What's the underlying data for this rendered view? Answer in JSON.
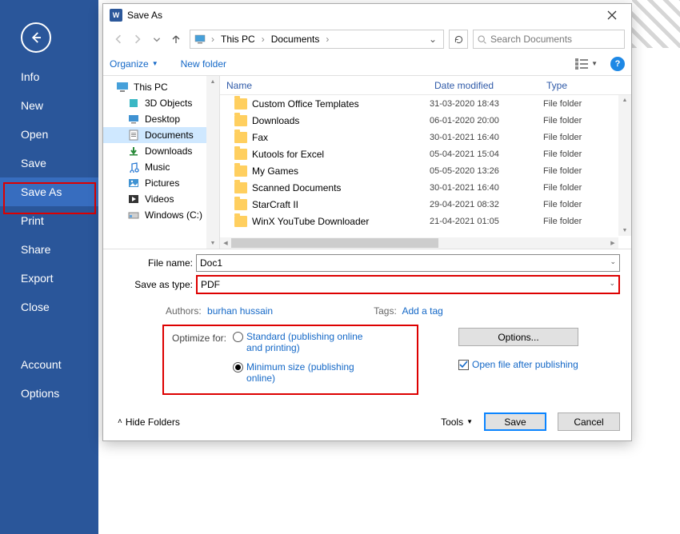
{
  "backstage": {
    "items": [
      "Info",
      "New",
      "Open",
      "Save",
      "Save As",
      "Print",
      "Share",
      "Export",
      "Close"
    ],
    "account": "Account",
    "options": "Options",
    "selected": "Save As"
  },
  "dialog": {
    "title": "Save As",
    "breadcrumb": {
      "root": "This PC",
      "folder": "Documents"
    },
    "search_placeholder": "Search Documents",
    "organize": "Organize",
    "new_folder": "New folder",
    "tree": [
      {
        "label": "This PC",
        "icon": "pc"
      },
      {
        "label": "3D Objects",
        "icon": "3d"
      },
      {
        "label": "Desktop",
        "icon": "desktop"
      },
      {
        "label": "Documents",
        "icon": "docs",
        "selected": true
      },
      {
        "label": "Downloads",
        "icon": "down"
      },
      {
        "label": "Music",
        "icon": "music"
      },
      {
        "label": "Pictures",
        "icon": "pics"
      },
      {
        "label": "Videos",
        "icon": "video"
      },
      {
        "label": "Windows (C:)",
        "icon": "disk"
      }
    ],
    "columns": {
      "name": "Name",
      "date": "Date modified",
      "type": "Type"
    },
    "files": [
      {
        "name": "Custom Office Templates",
        "date": "31-03-2020 18:43",
        "type": "File folder"
      },
      {
        "name": "Downloads",
        "date": "06-01-2020 20:00",
        "type": "File folder"
      },
      {
        "name": "Fax",
        "date": "30-01-2021 16:40",
        "type": "File folder"
      },
      {
        "name": "Kutools for Excel",
        "date": "05-04-2021 15:04",
        "type": "File folder"
      },
      {
        "name": "My Games",
        "date": "05-05-2020 13:26",
        "type": "File folder"
      },
      {
        "name": "Scanned Documents",
        "date": "30-01-2021 16:40",
        "type": "File folder"
      },
      {
        "name": "StarCraft II",
        "date": "29-04-2021 08:32",
        "type": "File folder"
      },
      {
        "name": "WinX YouTube Downloader",
        "date": "21-04-2021 01:05",
        "type": "File folder"
      }
    ],
    "filename_label": "File name:",
    "filename_value": "Doc1",
    "saveastype_label": "Save as type:",
    "saveastype_value": "PDF",
    "authors_label": "Authors:",
    "authors_value": "burhan hussain",
    "tags_label": "Tags:",
    "tags_value": "Add a tag",
    "optimize_label": "Optimize for:",
    "radio_std": "Standard (publishing online and printing)",
    "radio_min": "Minimum size (publishing online)",
    "options_btn": "Options...",
    "open_after": "Open file after publishing",
    "hide_folders": "Hide Folders",
    "tools": "Tools",
    "save": "Save",
    "cancel": "Cancel"
  }
}
